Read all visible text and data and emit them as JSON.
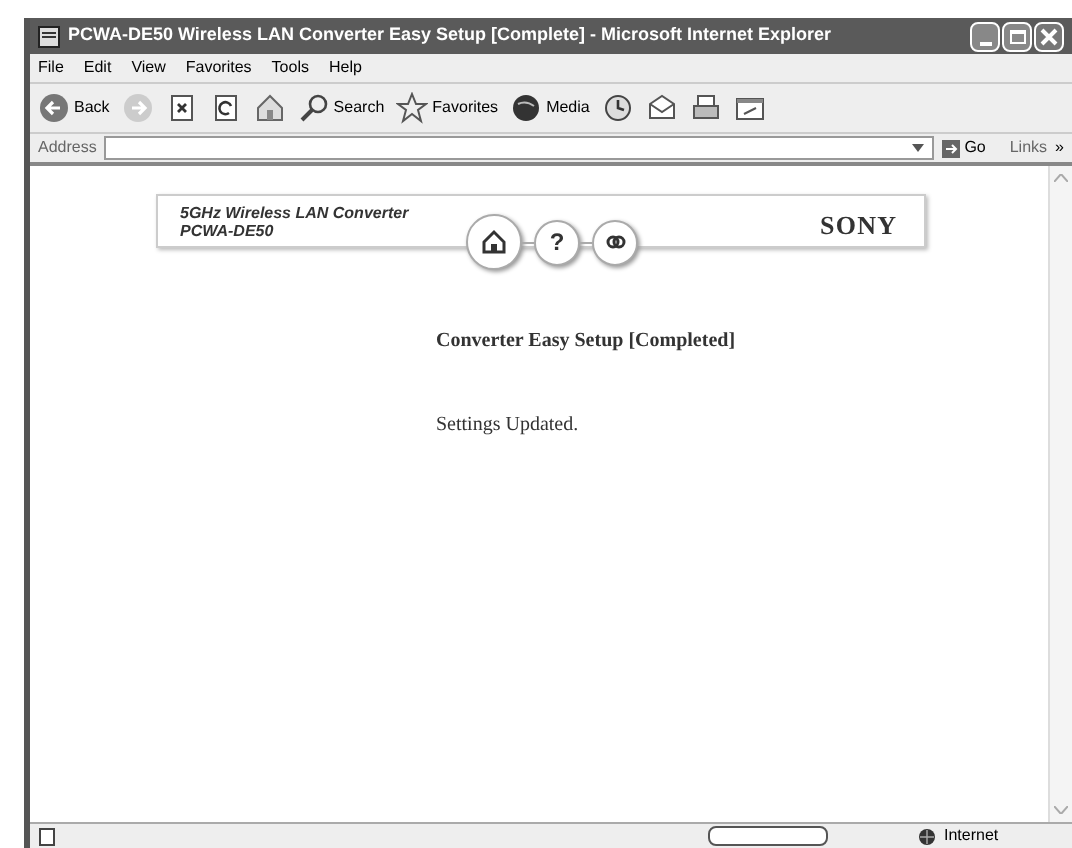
{
  "window": {
    "title": "PCWA-DE50 Wireless LAN Converter Easy Setup [Complete] - Microsoft Internet Explorer"
  },
  "menu": [
    "File",
    "Edit",
    "View",
    "Favorites",
    "Tools",
    "Help"
  ],
  "toolbar": [
    {
      "kind": "back",
      "label": "Back"
    },
    {
      "kind": "forward"
    },
    {
      "kind": "stop"
    },
    {
      "kind": "refresh"
    },
    {
      "kind": "home"
    },
    {
      "kind": "search",
      "label": "Search"
    },
    {
      "kind": "favorites",
      "label": "Favorites"
    },
    {
      "kind": "media",
      "label": "Media"
    },
    {
      "kind": "history"
    },
    {
      "kind": "mail"
    },
    {
      "kind": "print"
    },
    {
      "kind": "edit"
    }
  ],
  "address_bar": {
    "label": "Address",
    "go": "Go",
    "links": "Links",
    "more": "»"
  },
  "header": {
    "product_line": "5GHz Wireless LAN Converter",
    "model": "PCWA-DE50",
    "brand": "SONY",
    "nav": [
      {
        "kind": "home"
      },
      {
        "kind": "help",
        "label": "?"
      },
      {
        "kind": "link"
      }
    ]
  },
  "page": {
    "heading": "Converter Easy Setup [Completed]",
    "message": "Settings Updated."
  },
  "status_bar": {
    "zone": "Internet"
  }
}
